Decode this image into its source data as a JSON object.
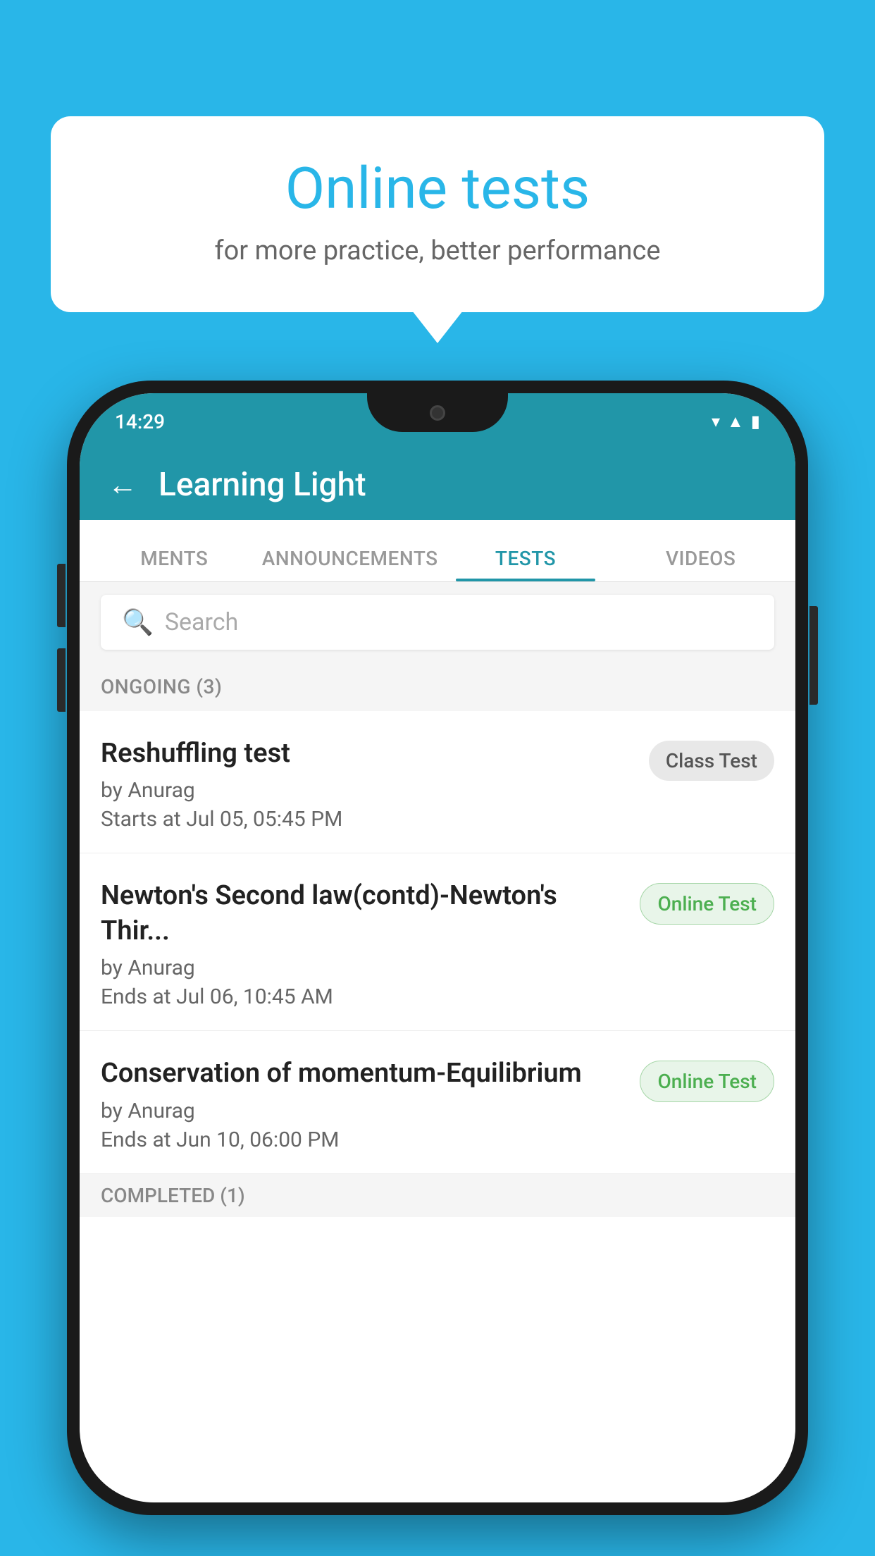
{
  "background_color": "#29B6E8",
  "speech_bubble": {
    "title": "Online tests",
    "subtitle": "for more practice, better performance"
  },
  "phone": {
    "status_bar": {
      "time": "14:29",
      "icons": [
        "wifi",
        "signal",
        "battery"
      ]
    },
    "app_header": {
      "title": "Learning Light",
      "back_label": "←"
    },
    "tabs": [
      {
        "label": "MENTS",
        "active": false
      },
      {
        "label": "ANNOUNCEMENTS",
        "active": false
      },
      {
        "label": "TESTS",
        "active": true
      },
      {
        "label": "VIDEOS",
        "active": false
      }
    ],
    "search": {
      "placeholder": "Search"
    },
    "ongoing_section": {
      "header": "ONGOING (3)",
      "items": [
        {
          "title": "Reshuffling test",
          "by": "by Anurag",
          "date": "Starts at  Jul 05, 05:45 PM",
          "badge": "Class Test",
          "badge_type": "class"
        },
        {
          "title": "Newton's Second law(contd)-Newton's Thir...",
          "by": "by Anurag",
          "date": "Ends at  Jul 06, 10:45 AM",
          "badge": "Online Test",
          "badge_type": "online"
        },
        {
          "title": "Conservation of momentum-Equilibrium",
          "by": "by Anurag",
          "date": "Ends at  Jun 10, 06:00 PM",
          "badge": "Online Test",
          "badge_type": "online"
        }
      ]
    },
    "completed_section": {
      "header": "COMPLETED (1)"
    }
  }
}
